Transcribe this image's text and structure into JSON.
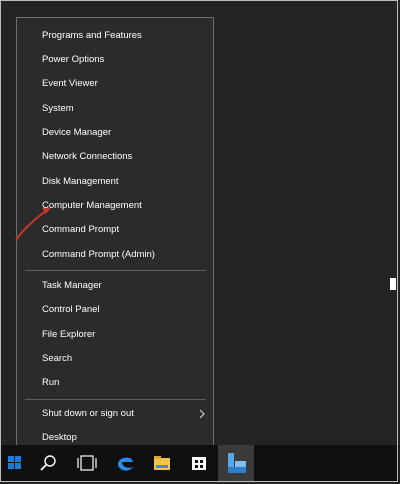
{
  "menu": {
    "group1": [
      {
        "label": "Programs and Features"
      },
      {
        "label": "Power Options"
      },
      {
        "label": "Event Viewer"
      },
      {
        "label": "System"
      },
      {
        "label": "Device Manager"
      },
      {
        "label": "Network Connections"
      },
      {
        "label": "Disk Management"
      },
      {
        "label": "Computer Management"
      },
      {
        "label": "Command Prompt"
      },
      {
        "label": "Command Prompt (Admin)"
      }
    ],
    "group2": [
      {
        "label": "Task Manager"
      },
      {
        "label": "Control Panel"
      },
      {
        "label": "File Explorer"
      },
      {
        "label": "Search"
      },
      {
        "label": "Run"
      }
    ],
    "group3": [
      {
        "label": "Shut down or sign out"
      },
      {
        "label": "Desktop"
      }
    ]
  },
  "colors": {
    "menu_bg": "#2b2b2b",
    "text": "#ffffff",
    "arrow": "#c0392b",
    "edge_accent": "#1e7bd6"
  },
  "taskbar_icons": [
    "windows-start-icon",
    "search-icon",
    "task-view-icon",
    "edge-browser-icon",
    "file-explorer-icon",
    "store-icon",
    "server-manager-icon"
  ]
}
